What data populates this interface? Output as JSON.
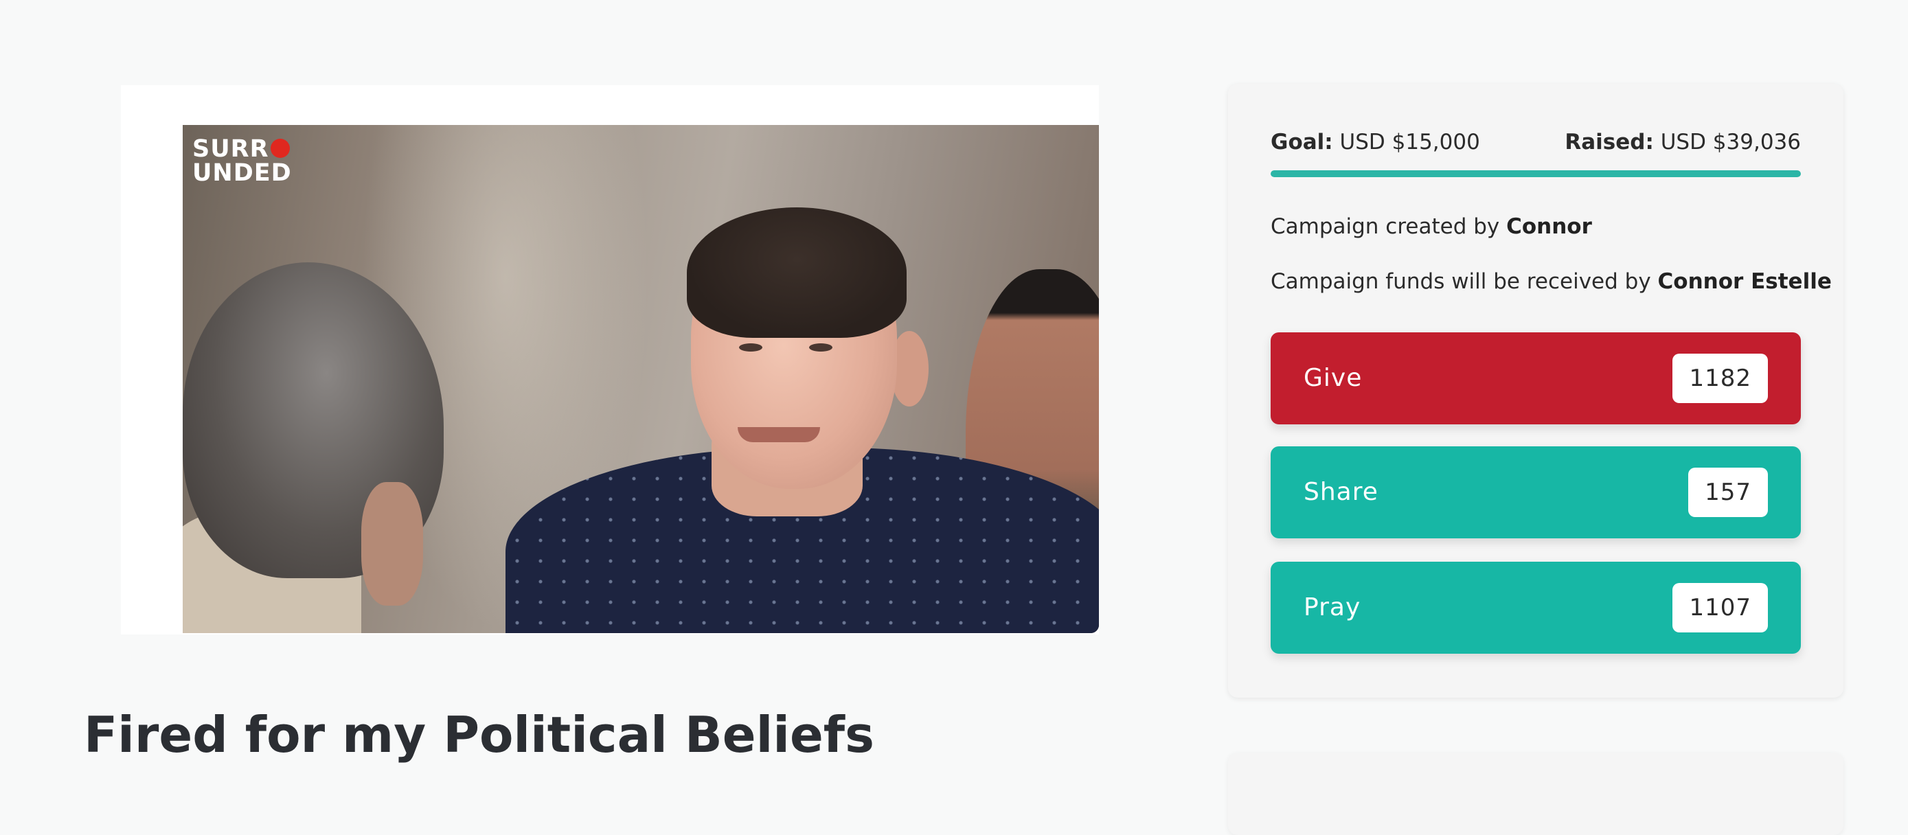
{
  "media": {
    "video_logo": [
      "SURR",
      "UNDED"
    ]
  },
  "page_title": "Fired for my Political Beliefs",
  "campaign": {
    "goal_label": "Goal:",
    "goal_value": "USD $15,000",
    "raised_label": "Raised:",
    "raised_value": "USD $39,036",
    "progress_fraction": 1.0,
    "created_by_prefix": "Campaign created by",
    "created_by_name": "Connor",
    "received_by_prefix": "Campaign funds will be received by",
    "received_by_name": "Connor Estelle"
  },
  "actions": {
    "give": {
      "label": "Give",
      "count": "1182"
    },
    "share": {
      "label": "Share",
      "count": "157"
    },
    "pray": {
      "label": "Pray",
      "count": "1107"
    }
  },
  "colors": {
    "give": "#c21e2e",
    "teal": "#17b7a5",
    "progress": "#2bb5a6",
    "background": "#f8f9f9"
  }
}
